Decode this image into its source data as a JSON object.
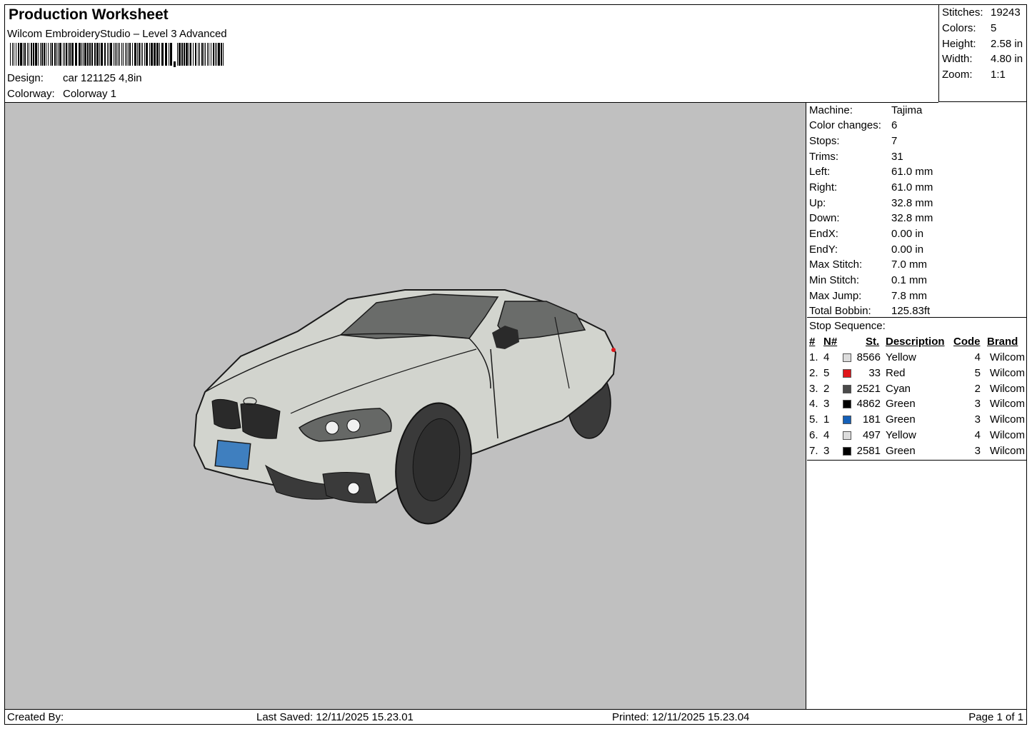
{
  "header": {
    "title": "Production Worksheet",
    "software": "Wilcom EmbroideryStudio – Level 3 Advanced",
    "design_label": "Design:",
    "design_value": "car 121125 4,8in",
    "colorway_label": "Colorway:",
    "colorway_value": "Colorway 1"
  },
  "stats": [
    {
      "label": "Stitches:",
      "value": "19243"
    },
    {
      "label": "Colors:",
      "value": "5"
    },
    {
      "label": "Height:",
      "value": "2.58 in"
    },
    {
      "label": "Width:",
      "value": "4.80 in"
    },
    {
      "label": "Zoom:",
      "value": "1:1"
    }
  ],
  "machine_info": [
    {
      "label": "Machine:",
      "value": "Tajima"
    },
    {
      "label": "Color changes:",
      "value": "6"
    },
    {
      "label": "Stops:",
      "value": "7"
    },
    {
      "label": "Trims:",
      "value": "31"
    },
    {
      "label": "Left:",
      "value": "61.0 mm"
    },
    {
      "label": "Right:",
      "value": "61.0 mm"
    },
    {
      "label": "Up:",
      "value": "32.8 mm"
    },
    {
      "label": "Down:",
      "value": "32.8 mm"
    },
    {
      "label": "EndX:",
      "value": "0.00 in"
    },
    {
      "label": "EndY:",
      "value": "0.00 in"
    },
    {
      "label": "Max Stitch:",
      "value": "7.0 mm"
    },
    {
      "label": "Min Stitch:",
      "value": "0.1 mm"
    },
    {
      "label": "Max Jump:",
      "value": "7.8 mm"
    },
    {
      "label": "Total Bobbin:",
      "value": "125.83ft"
    }
  ],
  "stop_sequence": {
    "title": "Stop Sequence:",
    "headers": [
      "#",
      "N#",
      "St.",
      "Description",
      "Code",
      "Brand"
    ],
    "rows": [
      {
        "index": "1.",
        "needle": "4",
        "color": "#dcdcdc",
        "stitches": "8566",
        "description": "Yellow",
        "code": "4",
        "brand": "Wilcom"
      },
      {
        "index": "2.",
        "needle": "5",
        "color": "#e0161b",
        "stitches": "33",
        "description": "Red",
        "code": "5",
        "brand": "Wilcom"
      },
      {
        "index": "3.",
        "needle": "2",
        "color": "#4a4a4a",
        "stitches": "2521",
        "description": "Cyan",
        "code": "2",
        "brand": "Wilcom"
      },
      {
        "index": "4.",
        "needle": "3",
        "color": "#000000",
        "stitches": "4862",
        "description": "Green",
        "code": "3",
        "brand": "Wilcom"
      },
      {
        "index": "5.",
        "needle": "1",
        "color": "#1560b8",
        "stitches": "181",
        "description": "Green",
        "code": "3",
        "brand": "Wilcom"
      },
      {
        "index": "6.",
        "needle": "4",
        "color": "#dcdcdc",
        "stitches": "497",
        "description": "Yellow",
        "code": "4",
        "brand": "Wilcom"
      },
      {
        "index": "7.",
        "needle": "3",
        "color": "#000000",
        "stitches": "2581",
        "description": "Green",
        "code": "3",
        "brand": "Wilcom"
      }
    ]
  },
  "footer": {
    "created_by": "Created By:",
    "last_saved": "Last Saved: 12/11/2025 15.23.01",
    "printed": "Printed: 12/11/2025 15.23.04",
    "page": "Page 1 of 1"
  },
  "design_preview": {
    "background": "#c0c0c0",
    "body_color": "#d2d4ce",
    "glass_color": "#6a6c6a",
    "tire_color": "#3a3a3a",
    "plate_color": "#3f7fbf"
  }
}
